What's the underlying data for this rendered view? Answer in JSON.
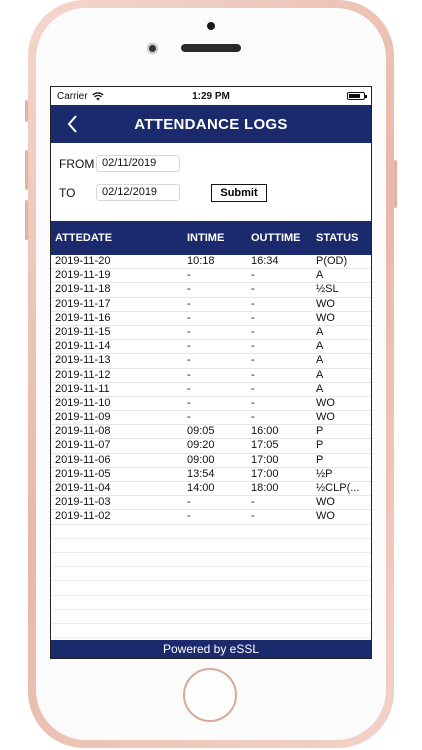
{
  "status_bar": {
    "carrier": "Carrier",
    "time": "1:29 PM"
  },
  "header": {
    "title": "ATTENDANCE LOGS"
  },
  "filter": {
    "from_label": "FROM",
    "from_value": "02/11/2019",
    "to_label": "TO",
    "to_value": "02/12/2019",
    "submit_label": "Submit"
  },
  "table": {
    "columns": [
      "ATTEDATE",
      "INTIME",
      "OUTTIME",
      "STATUS"
    ],
    "rows": [
      [
        "2019-11-20",
        "10:18",
        "16:34",
        "P(OD)"
      ],
      [
        "2019-11-19",
        "-",
        "-",
        "A"
      ],
      [
        "2019-11-18",
        "-",
        "-",
        "½SL"
      ],
      [
        "2019-11-17",
        "-",
        "-",
        "WO"
      ],
      [
        "2019-11-16",
        "-",
        "-",
        "WO"
      ],
      [
        "2019-11-15",
        "-",
        "-",
        "A"
      ],
      [
        "2019-11-14",
        "-",
        "-",
        "A"
      ],
      [
        "2019-11-13",
        "-",
        "-",
        "A"
      ],
      [
        "2019-11-12",
        "-",
        "-",
        "A"
      ],
      [
        "2019-11-11",
        "-",
        "-",
        "A"
      ],
      [
        "2019-11-10",
        "-",
        "-",
        "WO"
      ],
      [
        "2019-11-09",
        "-",
        "-",
        "WO"
      ],
      [
        "2019-11-08",
        "09:05",
        "16:00",
        "P"
      ],
      [
        "2019-11-07",
        "09:20",
        "17:05",
        "P"
      ],
      [
        "2019-11-06",
        "09:00",
        "17:00",
        "P"
      ],
      [
        "2019-11-05",
        "13:54",
        "17:00",
        "½P"
      ],
      [
        "2019-11-04",
        "14:00",
        "18:00",
        "½CLP(..."
      ],
      [
        "2019-11-03",
        "-",
        "-",
        "WO"
      ],
      [
        "2019-11-02",
        "-",
        "-",
        "WO"
      ]
    ]
  },
  "footer": {
    "text": "Powered by eSSL"
  },
  "colors": {
    "brand": "#1a2a6c",
    "frame": "#e8b8a8"
  }
}
